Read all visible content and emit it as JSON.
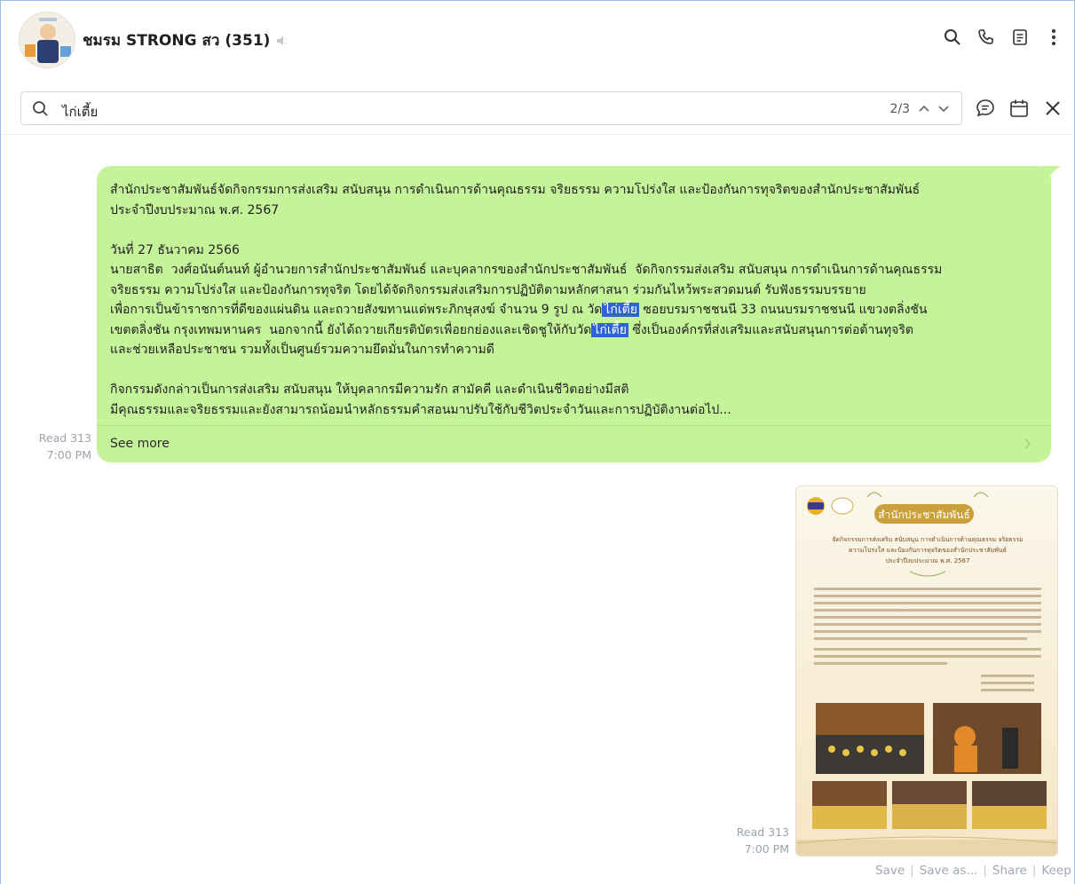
{
  "header": {
    "chat_name": "ชมรม STRONG สว",
    "member_count": "(351)",
    "icons": [
      "search-icon",
      "phone-icon",
      "notes-icon",
      "more-icon"
    ]
  },
  "search": {
    "query": "ไก่เตี้ย",
    "result_position": "2/3",
    "actions": [
      "chat-filter-icon",
      "calendar-icon",
      "close-icon"
    ]
  },
  "message": {
    "lines": {
      "p1": "สำนักประชาสัมพันธ์จัดกิจกรรมการส่งเสริม สนับสนุน การดำเนินการด้านคุณธรรม จริยธรรม ความโปร่งใส และป้องกันการทุจริตของสำนักประชาสัมพันธ์\nประจำปีงบประมาณ พ.ศ. 2567",
      "p2a": "วันที่ 27 ธันวาคม 2566\nนายสาธิต  วงศ์อนันต์นนท์ ผู้อำนวยการสำนักประชาสัมพันธ์ และบุคลากรของสำนักประชาสัมพันธ์  จัดกิจกรรมส่งเสริม สนับสนุน การดำเนินการด้านคุณธรรม\nจริยธรรม ความโปร่งใส และป้องกันการทุจริต โดยได้จัดกิจกรรมส่งเสริมการปฏิบัติตามหลักศาสนา ร่วมกันไหว้พระสวดมนต์ รับฟังธรรมบรรยาย\nเพื่อการเป็นข้าราชการที่ดีของแผ่นดิน และถวายสังฆทานแด่พระภิกษุสงฆ์ จำนวน 9 รูป ณ วัด",
      "hl1": "ไก่เตี้ย",
      "p2b": " ซอยบรมราชชนนี 33 ถนนบรมราชชนนี แขวงตลิ่งชัน\nเขตตลิ่งชัน กรุงเทพมหานคร  นอกจากนี้ ยังได้ถวายเกียรติบัตรเพื่อยกย่องและเชิดชูให้กับวัด",
      "hl2": "ไก่เตี้ย",
      "p2c": " ซึ่งเป็นองค์กรที่ส่งเสริมและสนับสนุนการต่อต้านทุจริต\nและช่วยเหลือประชาชน รวมทั้งเป็นศูนย์รวมความยึดมั่นในการทำความดี",
      "p3": "กิจกรรมดังกล่าวเป็นการส่งเสริม สนับสนุน ให้บุคลากรมีความรัก สามัคคี และดำเนินชีวิตอย่างมีสติ\nมีคุณธรรมและจริยธรรมและยังสามารถน้อมนำหลักธรรมคำสอนมาปรับใช้กับชีวิตประจำวันและการปฏิบัติงานต่อไป..."
    },
    "see_more": "See more",
    "read": "Read 313",
    "time": "7:00 PM"
  },
  "image_message": {
    "poster_title": "สำนักประชาสัมพันธ์",
    "poster_heading": "จัดกิจกรรมการส่งเสริม สนับสนุน การดำเนินการด้านคุณธรรม จริยธรรม\nความโปร่งใส และป้องกันการทุจริตของสำนักประชาสัมพันธ์\nประจำปีงบประมาณ พ.ศ. 2567",
    "read": "Read 313",
    "time": "7:00 PM",
    "actions": {
      "save": "Save",
      "save_as": "Save as...",
      "share": "Share",
      "keep": "Keep"
    }
  },
  "colors": {
    "bubble": "#c5f39a",
    "highlight": "#2f64d0",
    "meta": "#9aa3ad"
  }
}
